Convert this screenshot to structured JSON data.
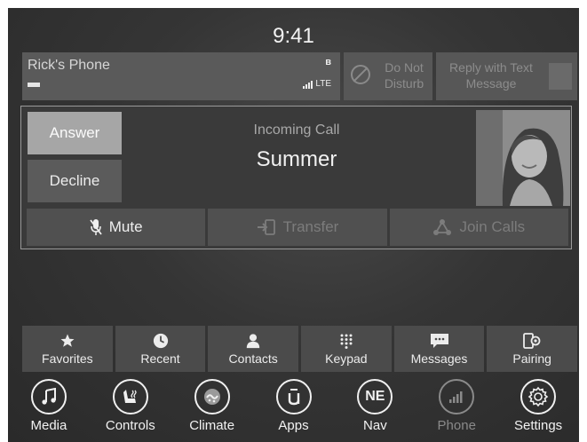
{
  "clock": "9:41",
  "status": {
    "phone_name": "Rick's Phone",
    "network": "LTE",
    "dnd_label": "Do Not Disturb",
    "reply_label": "Reply with Text Message"
  },
  "call": {
    "answer_label": "Answer",
    "decline_label": "Decline",
    "incoming_label": "Incoming Call",
    "caller_name": "Summer",
    "actions": [
      {
        "label": "Mute",
        "icon": "mute-mic-icon",
        "enabled": true
      },
      {
        "label": "Transfer",
        "icon": "transfer-icon",
        "enabled": false
      },
      {
        "label": "Join Calls",
        "icon": "join-calls-icon",
        "enabled": false
      }
    ]
  },
  "phone_nav": [
    {
      "label": "Favorites",
      "icon": "star-icon"
    },
    {
      "label": "Recent",
      "icon": "clock-icon"
    },
    {
      "label": "Contacts",
      "icon": "person-icon"
    },
    {
      "label": "Keypad",
      "icon": "keypad-icon"
    },
    {
      "label": "Messages",
      "icon": "message-icon"
    },
    {
      "label": "Pairing",
      "icon": "pairing-icon"
    }
  ],
  "main_nav": [
    {
      "label": "Media",
      "icon": "music-note-icon"
    },
    {
      "label": "Controls",
      "icon": "seat-icon"
    },
    {
      "label": "Climate",
      "icon": "climate-icon"
    },
    {
      "label": "Apps",
      "icon": "apps-icon"
    },
    {
      "label": "Nav",
      "icon": "compass-icon",
      "compass_text": "NE"
    },
    {
      "label": "Phone",
      "icon": "phone-signal-icon"
    },
    {
      "label": "Settings",
      "icon": "gear-icon"
    }
  ],
  "colors": {
    "background": "#353535",
    "panel": "#505050",
    "answer_button": "#a6a6a6",
    "text": "#f0f0f0",
    "disabled_text": "#7c7c7c"
  }
}
